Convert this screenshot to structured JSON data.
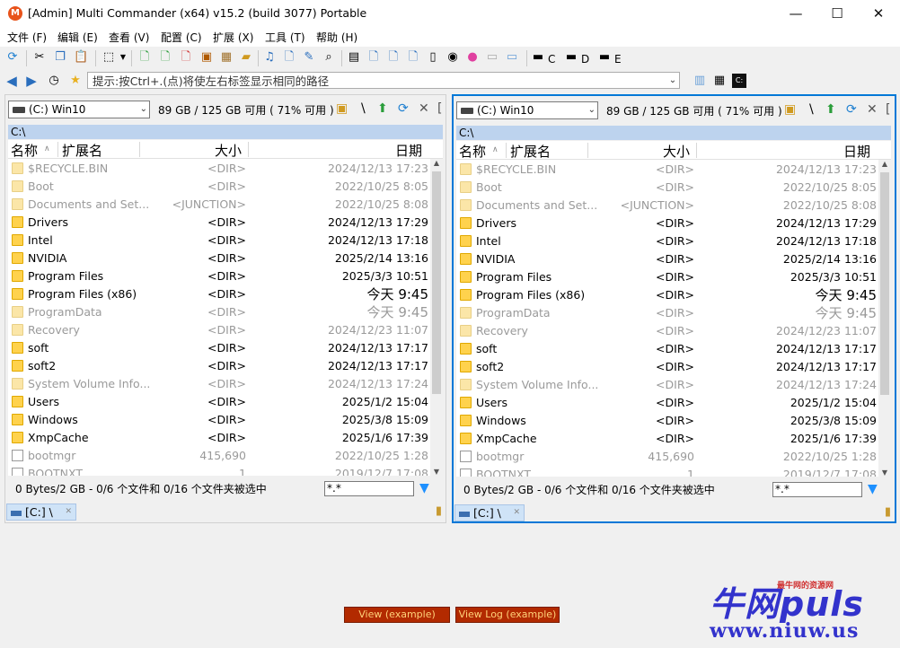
{
  "window": {
    "title": "[Admin] Multi Commander (x64)  v15.2 (build 3077) Portable",
    "min": "—",
    "max": "☐",
    "close": "✕"
  },
  "menu": [
    "文件 (F)",
    "编辑 (E)",
    "查看 (V)",
    "配置 (C)",
    "扩展 (X)",
    "工具 (T)",
    "帮助 (H)"
  ],
  "toolbar": {
    "drives": [
      "C",
      "D",
      "E"
    ]
  },
  "address": {
    "placeholder": "提示:按Ctrl+.(点)将使左右标签显示相同的路径"
  },
  "panels": [
    {
      "drive": "(C:) Win10",
      "free": "89 GB / 125 GB 可用 ( 71% 可用 )",
      "path": "C:\\",
      "columns": {
        "name": "名称",
        "ext": "扩展名",
        "size": "大小",
        "date": "日期"
      },
      "status": "0 Bytes/2 GB - 0/6 个文件和 0/16 个文件夹被选中",
      "filter": "*.*",
      "tab": "[C:] \\"
    },
    {
      "drive": "(C:) Win10",
      "free": "89 GB / 125 GB 可用 ( 71% 可用 )",
      "path": "C:\\",
      "columns": {
        "name": "名称",
        "ext": "扩展名",
        "size": "大小",
        "date": "日期"
      },
      "status": "0 Bytes/2 GB - 0/6 个文件和 0/16 个文件夹被选中",
      "filter": "*.*",
      "tab": "[C:] \\"
    }
  ],
  "files": [
    {
      "name": "$RECYCLE.BIN",
      "size": "<DIR>",
      "date": "2024/12/13 17:23",
      "dim": true,
      "type": "folder"
    },
    {
      "name": "Boot",
      "size": "<DIR>",
      "date": "2022/10/25 8:05",
      "dim": true,
      "type": "folder"
    },
    {
      "name": "Documents and Set...",
      "size": "<JUNCTION>",
      "date": "2022/10/25 8:08",
      "dim": true,
      "type": "folder"
    },
    {
      "name": "Drivers",
      "size": "<DIR>",
      "date": "2024/12/13 17:29",
      "dim": false,
      "type": "folder"
    },
    {
      "name": "Intel",
      "size": "<DIR>",
      "date": "2024/12/13 17:18",
      "dim": false,
      "type": "folder"
    },
    {
      "name": "NVIDIA",
      "size": "<DIR>",
      "date": "2025/2/14 13:16",
      "dim": false,
      "type": "folder"
    },
    {
      "name": "Program Files",
      "size": "<DIR>",
      "date": "2025/3/3 10:51",
      "dim": false,
      "type": "folder"
    },
    {
      "name": "Program Files (x86)",
      "size": "<DIR>",
      "date": "今天 9:45",
      "dim": false,
      "type": "folder",
      "big": true
    },
    {
      "name": "ProgramData",
      "size": "<DIR>",
      "date": "今天 9:45",
      "dim": true,
      "type": "folder",
      "big": true
    },
    {
      "name": "Recovery",
      "size": "<DIR>",
      "date": "2024/12/23 11:07",
      "dim": true,
      "type": "folder"
    },
    {
      "name": "soft",
      "size": "<DIR>",
      "date": "2024/12/13 17:17",
      "dim": false,
      "type": "folder"
    },
    {
      "name": "soft2",
      "size": "<DIR>",
      "date": "2024/12/13 17:17",
      "dim": false,
      "type": "folder"
    },
    {
      "name": "System Volume Info...",
      "size": "<DIR>",
      "date": "2024/12/13 17:24",
      "dim": true,
      "type": "folder"
    },
    {
      "name": "Users",
      "size": "<DIR>",
      "date": "2025/1/2 15:04",
      "dim": false,
      "type": "folder"
    },
    {
      "name": "Windows",
      "size": "<DIR>",
      "date": "2025/3/8 15:09",
      "dim": false,
      "type": "folder"
    },
    {
      "name": "XmpCache",
      "size": "<DIR>",
      "date": "2025/1/6 17:39",
      "dim": false,
      "type": "folder"
    },
    {
      "name": "bootmgr",
      "size": "415,690",
      "date": "2022/10/25 1:28",
      "dim": true,
      "type": "file"
    },
    {
      "name": "BOOTNXT",
      "size": "1",
      "date": "2019/12/7 17:08",
      "dim": true,
      "type": "file"
    }
  ],
  "bottom": {
    "view_example": "View (example)",
    "view_log_example": "View Log (example)"
  },
  "watermark": {
    "main": "牛网puls",
    "small": "最牛网的资源网",
    "url": "www.niuw.us"
  }
}
